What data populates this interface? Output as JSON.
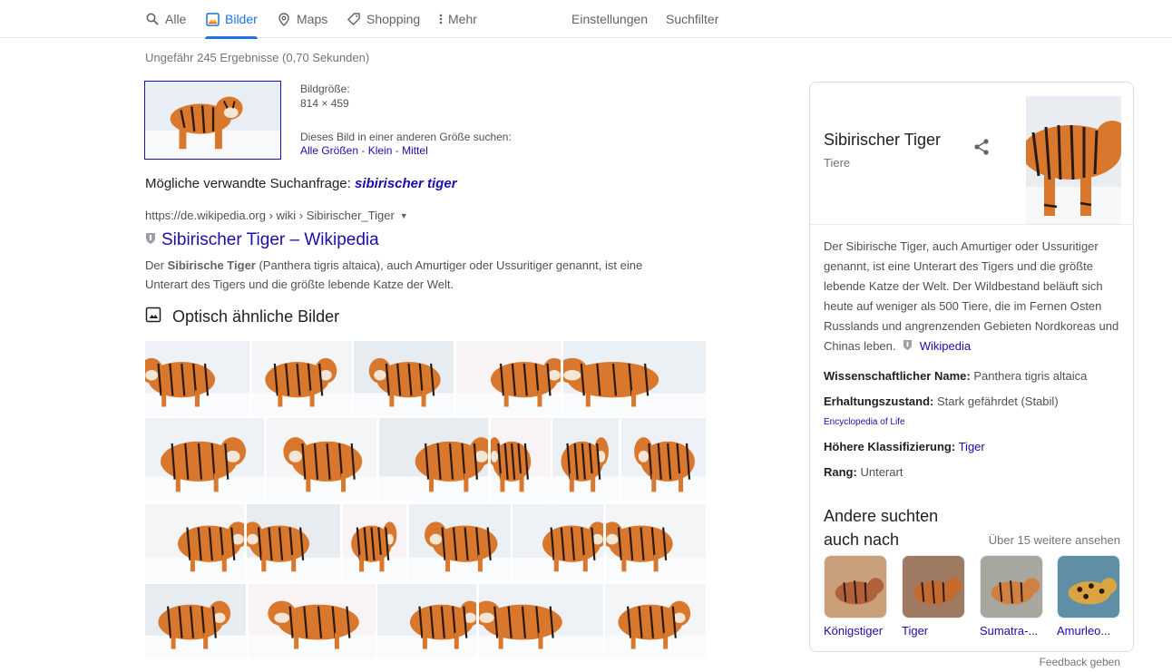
{
  "nav": {
    "tabs": [
      {
        "label": "Alle",
        "icon": "search-icon"
      },
      {
        "label": "Bilder",
        "icon": "image-icon"
      },
      {
        "label": "Maps",
        "icon": "map-pin-icon"
      },
      {
        "label": "Shopping",
        "icon": "tag-icon"
      },
      {
        "label": "Mehr",
        "icon": "more-vert-icon"
      }
    ],
    "active_tab": "Bilder",
    "settings": "Einstellungen",
    "filter": "Suchfilter"
  },
  "results": {
    "stats": "Ungefähr 245 Ergebnisse (0,70 Sekunden)",
    "image_size_label": "Bildgröße:",
    "image_size_value": "814 × 459",
    "other_sizes_text": "Dieses Bild in einer anderen Größe suchen:",
    "sizes_all": "Alle Größen",
    "sizes_sep1": " - ",
    "sizes_small": "Klein",
    "sizes_sep2": " - ",
    "sizes_medium": "Mittel",
    "related_label": "Mögliche verwandte Suchanfrage:",
    "related_query": "sibirischer tiger",
    "cite": "https://de.wikipedia.org › wiki › Sibirischer_Tiger",
    "title": "Sibirischer Tiger – Wikipedia",
    "snippet_pre": "Der ",
    "snippet_bold": "Sibirische Tiger",
    "snippet_post": " (Panthera tigris altaica), auch Amurtiger oder Ussuritiger genannt, ist eine Unterart des Tigers und die größte lebende Katze der Welt.",
    "similar_heading": "Optisch ähnliche Bilder"
  },
  "panel": {
    "title": "Sibirischer Tiger",
    "subtitle": "Tiere",
    "description": "Der Sibirische Tiger, auch Amurtiger oder Ussuritiger genannt, ist eine Unterart des Tigers und die größte lebende Katze der Welt. Der Wildbestand beläuft sich heute auf weniger als 500 Tiere, die im Fernen Osten Russlands und angrenzenden Gebieten Nordkoreas und Chinas leben.",
    "wiki_link": "Wikipedia",
    "facts": [
      {
        "label": "Wissenschaftlicher Name:",
        "value": "Panthera tigris altaica"
      },
      {
        "label": "Erhaltungszustand:",
        "value": "Stark gefährdet (Stabil)"
      },
      {
        "label": "Höhere Klassifizierung:",
        "value": "Tiger"
      },
      {
        "label": "Rang:",
        "value": "Unterart"
      }
    ],
    "source": "Encyclopedia of Life",
    "also_searched": "Andere suchten auch nach",
    "more_link": "Über 15 weitere ansehen",
    "related": [
      "Königstiger",
      "Tiger",
      "Sumatra-...",
      "Amurleo..."
    ]
  },
  "footer": {
    "feedback": "Feedback geben"
  },
  "colors": {
    "accent": "#1a73e8",
    "link": "#1a0dab",
    "tiger": "#d9782d",
    "snow": "#eef1f5"
  }
}
